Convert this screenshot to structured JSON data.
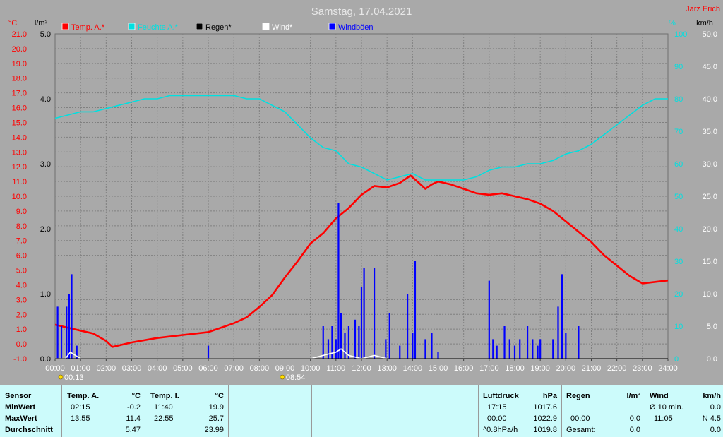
{
  "chart_data": {
    "type": "line",
    "title": "Samstag, 17.04.2021",
    "author": "Jarz Erich",
    "x_ticks": [
      "00:00",
      "01:00",
      "02:00",
      "03:00",
      "04:00",
      "05:00",
      "06:00",
      "07:00",
      "08:00",
      "09:00",
      "10:00",
      "11:00",
      "12:00",
      "13:00",
      "14:00",
      "15:00",
      "16:00",
      "17:00",
      "18:00",
      "19:00",
      "20:00",
      "21:00",
      "22:00",
      "23:00",
      "24:00"
    ],
    "xlim": [
      0,
      24
    ],
    "axes": {
      "temp": {
        "unit": "°C",
        "ylim": [
          -1,
          21
        ],
        "ticks": [
          "-1.0",
          "0.0",
          "1.0",
          "2.0",
          "3.0",
          "4.0",
          "5.0",
          "6.0",
          "7.0",
          "8.0",
          "9.0",
          "10.0",
          "11.0",
          "12.0",
          "13.0",
          "14.0",
          "15.0",
          "16.0",
          "17.0",
          "18.0",
          "19.0",
          "20.0",
          "21.0"
        ]
      },
      "rain": {
        "unit": "l/m²",
        "ylim": [
          0,
          5
        ],
        "ticks": [
          "0.0",
          "1.0",
          "2.0",
          "3.0",
          "4.0",
          "5.0"
        ]
      },
      "humidity": {
        "unit": "%",
        "ylim": [
          0,
          100
        ],
        "ticks": [
          "0",
          "10",
          "20",
          "30",
          "40",
          "50",
          "60",
          "70",
          "80",
          "90",
          "100"
        ]
      },
      "wind": {
        "unit": "km/h",
        "ylim": [
          0,
          50
        ],
        "ticks": [
          "0.0",
          "5.0",
          "10.0",
          "15.0",
          "20.0",
          "25.0",
          "30.0",
          "35.0",
          "40.0",
          "45.0",
          "50.0"
        ]
      }
    },
    "legend": [
      {
        "name": "Temp. A.*",
        "color": "#ff0000"
      },
      {
        "name": "Feuchte A.*",
        "color": "#00e0e0"
      },
      {
        "name": "Regen*",
        "color": "#000000"
      },
      {
        "name": "Wind*",
        "color": "#ffffff"
      },
      {
        "name": "Windböen",
        "color": "#0000ff"
      }
    ],
    "sun_events": [
      {
        "x": 0.22,
        "label": "00:13"
      },
      {
        "x": 8.9,
        "label": "08:54"
      }
    ],
    "series": [
      {
        "name": "Temp. A.*",
        "axis": "temp",
        "color": "#ff0000",
        "x": [
          0,
          0.5,
          1,
          1.5,
          2,
          2.25,
          3,
          4,
          5,
          6,
          6.5,
          7,
          7.5,
          8,
          8.5,
          9,
          9.5,
          10,
          10.5,
          11,
          11.5,
          12,
          12.5,
          13,
          13.5,
          13.92,
          14.25,
          14.5,
          14.75,
          15,
          15.5,
          16,
          16.5,
          17,
          17.5,
          18,
          18.5,
          19,
          19.5,
          20,
          20.5,
          21,
          21.5,
          22,
          22.5,
          23,
          23.5,
          24
        ],
        "values": [
          1.3,
          1.1,
          0.9,
          0.7,
          0.2,
          -0.2,
          0.1,
          0.4,
          0.6,
          0.8,
          1.1,
          1.4,
          1.8,
          2.5,
          3.3,
          4.5,
          5.6,
          6.8,
          7.5,
          8.5,
          9.2,
          10.1,
          10.7,
          10.6,
          10.9,
          11.4,
          10.9,
          10.5,
          10.8,
          11.0,
          10.8,
          10.5,
          10.2,
          10.1,
          10.2,
          10.0,
          9.8,
          9.5,
          9.0,
          8.3,
          7.6,
          6.9,
          6.0,
          5.3,
          4.6,
          4.1,
          4.2,
          4.3
        ]
      },
      {
        "name": "Feuchte A.*",
        "axis": "humidity",
        "color": "#00e0e0",
        "x": [
          0,
          0.5,
          1,
          1.5,
          2,
          2.5,
          3,
          3.5,
          4,
          4.5,
          5,
          5.5,
          6,
          6.5,
          7,
          7.5,
          8,
          8.5,
          9,
          9.5,
          10,
          10.5,
          11,
          11.5,
          12,
          12.5,
          13,
          13.5,
          14,
          14.5,
          15,
          15.5,
          16,
          16.5,
          17,
          17.5,
          18,
          18.5,
          19,
          19.5,
          20,
          20.5,
          21,
          21.5,
          22,
          22.5,
          23,
          23.5,
          24
        ],
        "values": [
          74,
          75,
          76,
          76,
          77,
          78,
          79,
          80,
          80,
          81,
          81,
          81,
          81,
          81,
          81,
          80,
          80,
          78,
          76,
          72,
          68,
          65,
          64,
          60,
          59,
          57,
          55,
          56,
          57,
          55,
          55,
          55,
          55,
          56,
          58,
          59,
          59,
          60,
          60,
          61,
          63,
          64,
          66,
          69,
          72,
          75,
          78,
          80,
          80
        ]
      },
      {
        "name": "Windböen",
        "axis": "wind",
        "type": "bars",
        "color": "#0000ff",
        "x": [
          0.1,
          0.25,
          0.45,
          0.55,
          0.65,
          0.85,
          6.0,
          10.5,
          10.7,
          10.85,
          11.0,
          11.1,
          11.2,
          11.35,
          11.5,
          11.75,
          11.9,
          12.0,
          12.1,
          12.5,
          12.95,
          13.1,
          13.5,
          13.8,
          14.0,
          14.1,
          14.5,
          14.75,
          15.0,
          17.0,
          17.15,
          17.3,
          17.6,
          17.8,
          18.0,
          18.2,
          18.5,
          18.7,
          18.9,
          19.0,
          19.5,
          19.7,
          19.85,
          20.0,
          20.5
        ],
        "values": [
          8,
          5,
          8,
          10,
          13,
          2,
          2,
          5,
          3,
          5,
          3,
          24,
          7,
          4,
          5,
          6,
          5,
          11,
          14,
          14,
          3,
          7,
          2,
          10,
          4,
          15,
          3,
          4,
          1,
          12,
          3,
          2,
          5,
          3,
          2,
          3,
          5,
          3,
          2,
          3,
          3,
          8,
          13,
          4,
          5
        ]
      },
      {
        "name": "Wind*",
        "axis": "wind",
        "color": "#ffffff",
        "x": [
          0,
          0.4,
          0.6,
          0.8,
          1,
          1.2,
          10,
          11,
          11.2,
          11.5,
          12,
          12.5,
          13
        ],
        "values": [
          0,
          0,
          1,
          0.5,
          0,
          0,
          0,
          1,
          1.5,
          0.5,
          0,
          0.5,
          0
        ]
      },
      {
        "name": "Regen*",
        "axis": "rain",
        "color": "#000000",
        "x": [
          0,
          24
        ],
        "values": [
          0,
          0
        ]
      }
    ]
  },
  "stats": {
    "c1": {
      "header": "Sensor",
      "rows": [
        "MinWert",
        "MaxWert",
        "Durchschnitt"
      ]
    },
    "c2": {
      "header": "Temp. A.",
      "unit": "°C",
      "times": [
        "02:15",
        "13:55",
        ""
      ],
      "values": [
        "-0.2",
        "11.4",
        "5.47"
      ]
    },
    "c3": {
      "header": "Temp. I.",
      "unit": "°C",
      "times": [
        "11:40",
        "22:55",
        ""
      ],
      "values": [
        "19.9",
        "25.7",
        "23.99"
      ]
    },
    "c4": {
      "header": "Luftdruck",
      "unit": "hPa",
      "times": [
        "17:15",
        "00:00",
        "^0.8hPa/h"
      ],
      "values": [
        "1017.6",
        "1022.9",
        "1019.8"
      ]
    },
    "c5": {
      "header": "Regen",
      "unit": "l/m²",
      "times": [
        "",
        "00:00",
        "Gesamt:"
      ],
      "values": [
        "",
        "0.0",
        "0.0"
      ]
    },
    "c6": {
      "header": "Wind",
      "unit": "km/h",
      "times": [
        "Ø 10 min.",
        "11:05",
        ""
      ],
      "values": [
        "0.0",
        "N 4.5",
        "0.0"
      ]
    }
  }
}
